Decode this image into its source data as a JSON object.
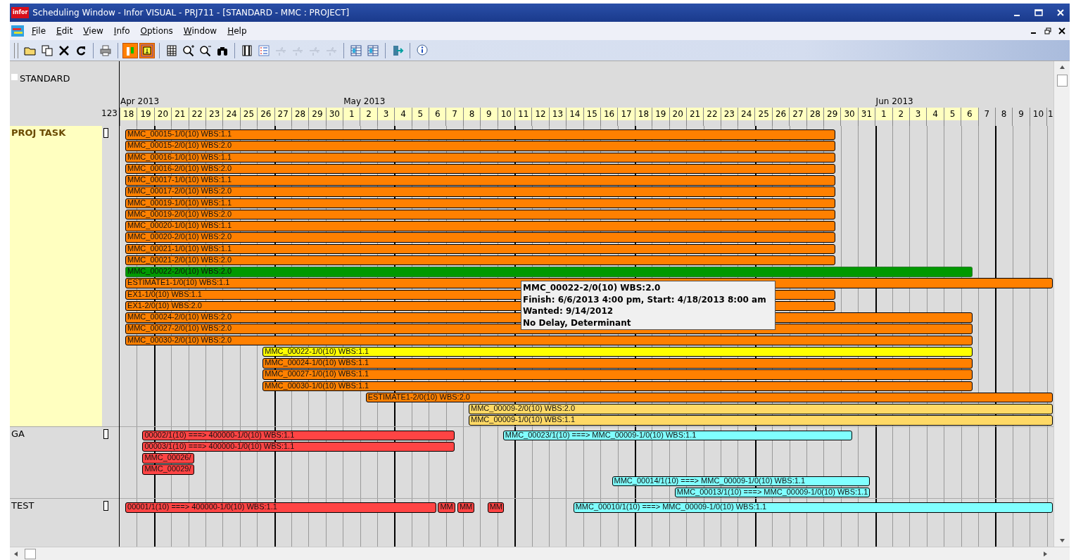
{
  "window": {
    "logo_text": "infor",
    "title": "Scheduling Window - Infor VISUAL - PRJ711 - [STANDARD - MMC : PROJECT]"
  },
  "menu": [
    {
      "label": "File"
    },
    {
      "label": "Edit"
    },
    {
      "label": "View"
    },
    {
      "label": "Info"
    },
    {
      "label": "Options"
    },
    {
      "label": "Window"
    },
    {
      "label": "Help"
    }
  ],
  "toolbar": [
    {
      "kind": "grip"
    },
    {
      "kind": "folder",
      "selected": false,
      "disabled": false
    },
    {
      "kind": "copy",
      "selected": false,
      "disabled": false
    },
    {
      "kind": "delete",
      "selected": false,
      "disabled": false
    },
    {
      "kind": "refresh",
      "selected": false,
      "disabled": false
    },
    {
      "kind": "separator"
    },
    {
      "kind": "print",
      "selected": false,
      "disabled": false
    },
    {
      "kind": "separator"
    },
    {
      "kind": "bars",
      "selected": true,
      "disabled": false
    },
    {
      "kind": "tree",
      "selected": true,
      "disabled": false
    },
    {
      "kind": "separator"
    },
    {
      "kind": "grid",
      "selected": false,
      "disabled": false
    },
    {
      "kind": "zoomin",
      "selected": false,
      "disabled": false
    },
    {
      "kind": "zoomout",
      "selected": false,
      "disabled": false
    },
    {
      "kind": "binoculars",
      "selected": false,
      "disabled": false
    },
    {
      "kind": "separator"
    },
    {
      "kind": "film",
      "selected": false,
      "disabled": false
    },
    {
      "kind": "list",
      "selected": false,
      "disabled": false
    },
    {
      "kind": "hand",
      "selected": false,
      "disabled": true
    },
    {
      "kind": "hand",
      "selected": false,
      "disabled": true
    },
    {
      "kind": "hand",
      "selected": false,
      "disabled": true
    },
    {
      "kind": "hand",
      "selected": false,
      "disabled": true
    },
    {
      "kind": "separator"
    },
    {
      "kind": "table",
      "selected": false,
      "disabled": false
    },
    {
      "kind": "table",
      "selected": false,
      "disabled": false
    },
    {
      "kind": "separator"
    },
    {
      "kind": "exit",
      "selected": false,
      "disabled": false
    },
    {
      "kind": "separator"
    },
    {
      "kind": "info",
      "selected": false,
      "disabled": false
    }
  ],
  "view": {
    "name": "STANDARD",
    "scale_label": "123"
  },
  "timeline": {
    "months": [
      {
        "label": "Apr 2013"
      },
      {
        "label": "May 2013"
      },
      {
        "label": "Jun 2013"
      }
    ],
    "days": [
      {
        "label": "18",
        "highlighted": true
      },
      {
        "label": "19",
        "highlighted": true
      },
      {
        "label": "20",
        "highlighted": true
      },
      {
        "label": "21",
        "highlighted": true
      },
      {
        "label": "22",
        "highlighted": true
      },
      {
        "label": "23",
        "highlighted": true
      },
      {
        "label": "24",
        "highlighted": true
      },
      {
        "label": "25",
        "highlighted": true
      },
      {
        "label": "26",
        "highlighted": true
      },
      {
        "label": "27",
        "highlighted": true
      },
      {
        "label": "28",
        "highlighted": true
      },
      {
        "label": "29",
        "highlighted": true
      },
      {
        "label": "30",
        "highlighted": true
      },
      {
        "label": "1",
        "highlighted": true
      },
      {
        "label": "2",
        "highlighted": true
      },
      {
        "label": "3",
        "highlighted": true
      },
      {
        "label": "4",
        "highlighted": true
      },
      {
        "label": "5",
        "highlighted": true
      },
      {
        "label": "6",
        "highlighted": true
      },
      {
        "label": "7",
        "highlighted": true
      },
      {
        "label": "8",
        "highlighted": true
      },
      {
        "label": "9",
        "highlighted": true
      },
      {
        "label": "10",
        "highlighted": true
      },
      {
        "label": "11",
        "highlighted": true
      },
      {
        "label": "12",
        "highlighted": true
      },
      {
        "label": "13",
        "highlighted": true
      },
      {
        "label": "14",
        "highlighted": true
      },
      {
        "label": "15",
        "highlighted": true
      },
      {
        "label": "16",
        "highlighted": true
      },
      {
        "label": "17",
        "highlighted": true
      },
      {
        "label": "18",
        "highlighted": true
      },
      {
        "label": "19",
        "highlighted": true
      },
      {
        "label": "20",
        "highlighted": true
      },
      {
        "label": "21",
        "highlighted": true
      },
      {
        "label": "22",
        "highlighted": true
      },
      {
        "label": "23",
        "highlighted": true
      },
      {
        "label": "24",
        "highlighted": true
      },
      {
        "label": "25",
        "highlighted": true
      },
      {
        "label": "26",
        "highlighted": true
      },
      {
        "label": "27",
        "highlighted": true
      },
      {
        "label": "28",
        "highlighted": true
      },
      {
        "label": "29",
        "highlighted": true
      },
      {
        "label": "30",
        "highlighted": true
      },
      {
        "label": "31",
        "highlighted": true
      },
      {
        "label": "1",
        "highlighted": true
      },
      {
        "label": "2",
        "highlighted": true
      },
      {
        "label": "3",
        "highlighted": true
      },
      {
        "label": "4",
        "highlighted": true
      },
      {
        "label": "5",
        "highlighted": true
      },
      {
        "label": "6",
        "highlighted": true
      },
      {
        "label": "7",
        "highlighted": false
      },
      {
        "label": "8",
        "highlighted": false
      },
      {
        "label": "9",
        "highlighted": false
      },
      {
        "label": "10",
        "highlighted": false
      },
      {
        "label": "1",
        "highlighted": false
      }
    ]
  },
  "groups": [
    {
      "label": "PROJ TASK",
      "selected": true,
      "lanes": [
        [
          {
            "text": "MMC_00015-1/0(10)  WBS:1.1",
            "color": "#ff8000",
            "selected": false
          }
        ],
        [
          {
            "text": "MMC_00015-2/0(10)  WBS:2.0",
            "color": "#ff8000",
            "selected": false
          }
        ],
        [
          {
            "text": "MMC_00016-1/0(10)  WBS:1.1",
            "color": "#ff8000",
            "selected": false
          }
        ],
        [
          {
            "text": "MMC_00016-2/0(10)  WBS:2.0",
            "color": "#ff8000",
            "selected": false
          }
        ],
        [
          {
            "text": "MMC_00017-1/0(10)  WBS:1.1",
            "color": "#ff8000",
            "selected": false
          }
        ],
        [
          {
            "text": "MMC_00017-2/0(10)  WBS:2.0",
            "color": "#ff8000",
            "selected": false
          }
        ],
        [
          {
            "text": "MMC_00019-1/0(10)  WBS:1.1",
            "color": "#ff8000",
            "selected": false
          }
        ],
        [
          {
            "text": "MMC_00019-2/0(10)  WBS:2.0",
            "color": "#ff8000",
            "selected": false
          }
        ],
        [
          {
            "text": "MMC_00020-1/0(10)  WBS:1.1",
            "color": "#ff8000",
            "selected": false
          }
        ],
        [
          {
            "text": "MMC_00020-2/0(10)  WBS:2.0",
            "color": "#ff8000",
            "selected": false
          }
        ],
        [
          {
            "text": "MMC_00021-1/0(10)  WBS:1.1",
            "color": "#ff8000",
            "selected": false
          }
        ],
        [
          {
            "text": "MMC_00021-2/0(10)  WBS:2.0",
            "color": "#ff8000",
            "selected": false
          }
        ],
        [
          {
            "text": "MMC_00022-2/0(10)  WBS:2.0",
            "color": "#009900",
            "selected": true
          }
        ],
        [
          {
            "text": "ESTIMATE1-1/0(10)  WBS:1.1",
            "color": "#ff8000",
            "selected": false
          }
        ],
        [
          {
            "text": "EX1-1/0(10)  WBS:1.1",
            "color": "#ff8000",
            "selected": false
          }
        ],
        [
          {
            "text": "EX1-2/0(10)  WBS:2.0",
            "color": "#ff8000",
            "selected": false
          }
        ],
        [
          {
            "text": "MMC_00024-2/0(10)  WBS:2.0",
            "color": "#ff8000",
            "selected": false
          }
        ],
        [
          {
            "text": "MMC_00027-2/0(10)  WBS:2.0",
            "color": "#ff8000",
            "selected": false
          }
        ],
        [
          {
            "text": "MMC_00030-2/0(10)  WBS:2.0",
            "color": "#ff8000",
            "selected": false
          }
        ],
        [
          {
            "text": "MMC_00022-1/0(10)  WBS:1.1",
            "color": "#ffff00",
            "selected": false
          }
        ],
        [
          {
            "text": "MMC_00024-1/0(10)  WBS:1.1",
            "color": "#ff8000",
            "selected": false
          }
        ],
        [
          {
            "text": "MMC_00027-1/0(10)  WBS:1.1",
            "color": "#ff8000",
            "selected": false
          }
        ],
        [
          {
            "text": "MMC_00030-1/0(10)  WBS:1.1",
            "color": "#ff8000",
            "selected": false
          }
        ],
        [
          {
            "text": "ESTIMATE1-2/0(10)  WBS:2.0",
            "color": "#ff8000",
            "selected": false
          }
        ],
        [
          {
            "text": "MMC_00009-2/0(10)  WBS:2.0",
            "color": "#ffd966",
            "selected": false
          }
        ],
        [
          {
            "text": "MMC_00009-1/0(10)  WBS:1.1",
            "color": "#ffd966",
            "selected": false
          }
        ]
      ]
    },
    {
      "label": "GA",
      "selected": false,
      "lanes": [
        [
          {
            "text": "00002/1(10) ===> 400000-1/0(10)  WBS:1.1",
            "color": "#ff4444",
            "selected": false
          },
          {
            "text": "MMC_00023/1(10) ===> MMC_00009-1/0(10)  WBS:1.1",
            "color": "#80ffff",
            "selected": false
          }
        ],
        [
          {
            "text": "00003/1(10) ===> 400000-1/0(10)  WBS:1.1",
            "color": "#ff4444",
            "selected": false
          }
        ],
        [
          {
            "text": "MMC_00026/",
            "color": "#ff4444",
            "selected": false
          }
        ],
        [
          {
            "text": "MMC_00029/",
            "color": "#ff4444",
            "selected": false
          }
        ],
        [
          {
            "text": "MMC_00014/1(10) ===> MMC_00009-1/0(10)  WBS:1.1",
            "color": "#80ffff",
            "selected": false
          }
        ],
        [
          {
            "text": "MMC_00013/1(10) ===> MMC_00009-1/0(10)  WBS:1.1",
            "color": "#80ffff",
            "selected": false
          }
        ]
      ]
    },
    {
      "label": "TEST",
      "selected": false,
      "lanes": [
        [
          {
            "text": "00001/1(10) ===> 400000-1/0(10)  WBS:1.1",
            "color": "#ff4444",
            "selected": false
          },
          {
            "text": "MM",
            "color": "#ff4444",
            "selected": false
          },
          {
            "text": "MM",
            "color": "#ff4444",
            "selected": false
          },
          {
            "text": "MM",
            "color": "#ff4444",
            "selected": false
          },
          {
            "text": "MMC_00010/1(10) ===> MMC_00009-1/0(10)  WBS:1.1",
            "color": "#80ffff",
            "selected": false
          }
        ]
      ]
    }
  ],
  "tooltip": {
    "lines": [
      "MMC_00022-2/0(10)  WBS:2.0",
      "Finish: 6/6/2013 4:00 pm, Start: 4/18/2013 8:00 am",
      "Wanted: 9/14/2012",
      "No Delay, Determinant"
    ]
  }
}
